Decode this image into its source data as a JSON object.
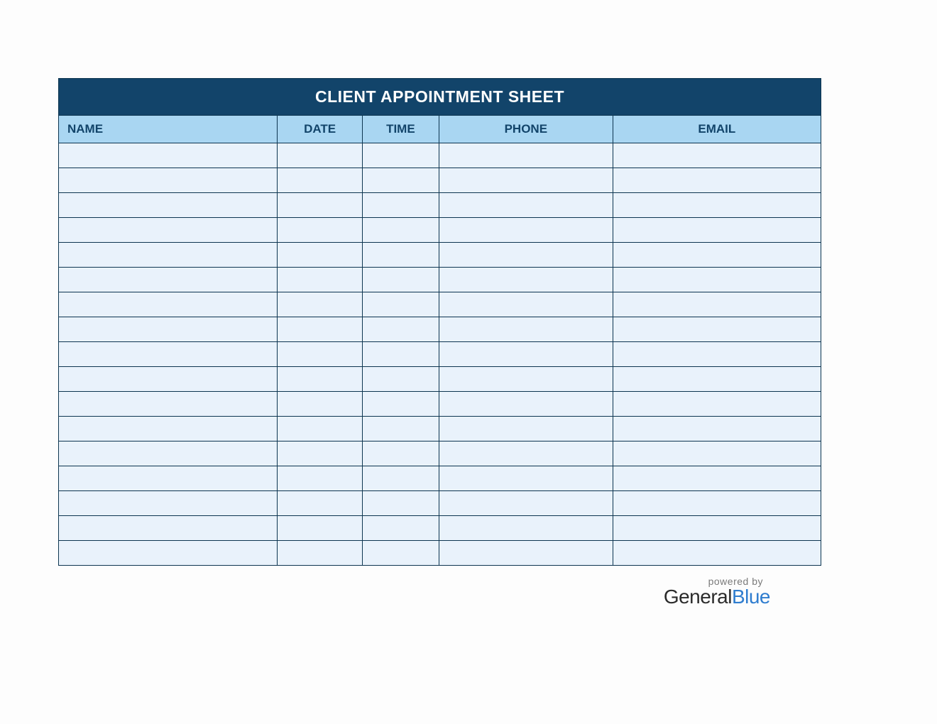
{
  "title": "CLIENT APPOINTMENT SHEET",
  "columns": {
    "name": "NAME",
    "date": "DATE",
    "time": "TIME",
    "phone": "PHONE",
    "email": "EMAIL"
  },
  "rows": [
    {
      "name": "",
      "date": "",
      "time": "",
      "phone": "",
      "email": ""
    },
    {
      "name": "",
      "date": "",
      "time": "",
      "phone": "",
      "email": ""
    },
    {
      "name": "",
      "date": "",
      "time": "",
      "phone": "",
      "email": ""
    },
    {
      "name": "",
      "date": "",
      "time": "",
      "phone": "",
      "email": ""
    },
    {
      "name": "",
      "date": "",
      "time": "",
      "phone": "",
      "email": ""
    },
    {
      "name": "",
      "date": "",
      "time": "",
      "phone": "",
      "email": ""
    },
    {
      "name": "",
      "date": "",
      "time": "",
      "phone": "",
      "email": ""
    },
    {
      "name": "",
      "date": "",
      "time": "",
      "phone": "",
      "email": ""
    },
    {
      "name": "",
      "date": "",
      "time": "",
      "phone": "",
      "email": ""
    },
    {
      "name": "",
      "date": "",
      "time": "",
      "phone": "",
      "email": ""
    },
    {
      "name": "",
      "date": "",
      "time": "",
      "phone": "",
      "email": ""
    },
    {
      "name": "",
      "date": "",
      "time": "",
      "phone": "",
      "email": ""
    },
    {
      "name": "",
      "date": "",
      "time": "",
      "phone": "",
      "email": ""
    },
    {
      "name": "",
      "date": "",
      "time": "",
      "phone": "",
      "email": ""
    },
    {
      "name": "",
      "date": "",
      "time": "",
      "phone": "",
      "email": ""
    },
    {
      "name": "",
      "date": "",
      "time": "",
      "phone": "",
      "email": ""
    },
    {
      "name": "",
      "date": "",
      "time": "",
      "phone": "",
      "email": ""
    }
  ],
  "footer": {
    "powered_by": "powered by",
    "brand_part1": "General",
    "brand_part2": "Blue"
  }
}
